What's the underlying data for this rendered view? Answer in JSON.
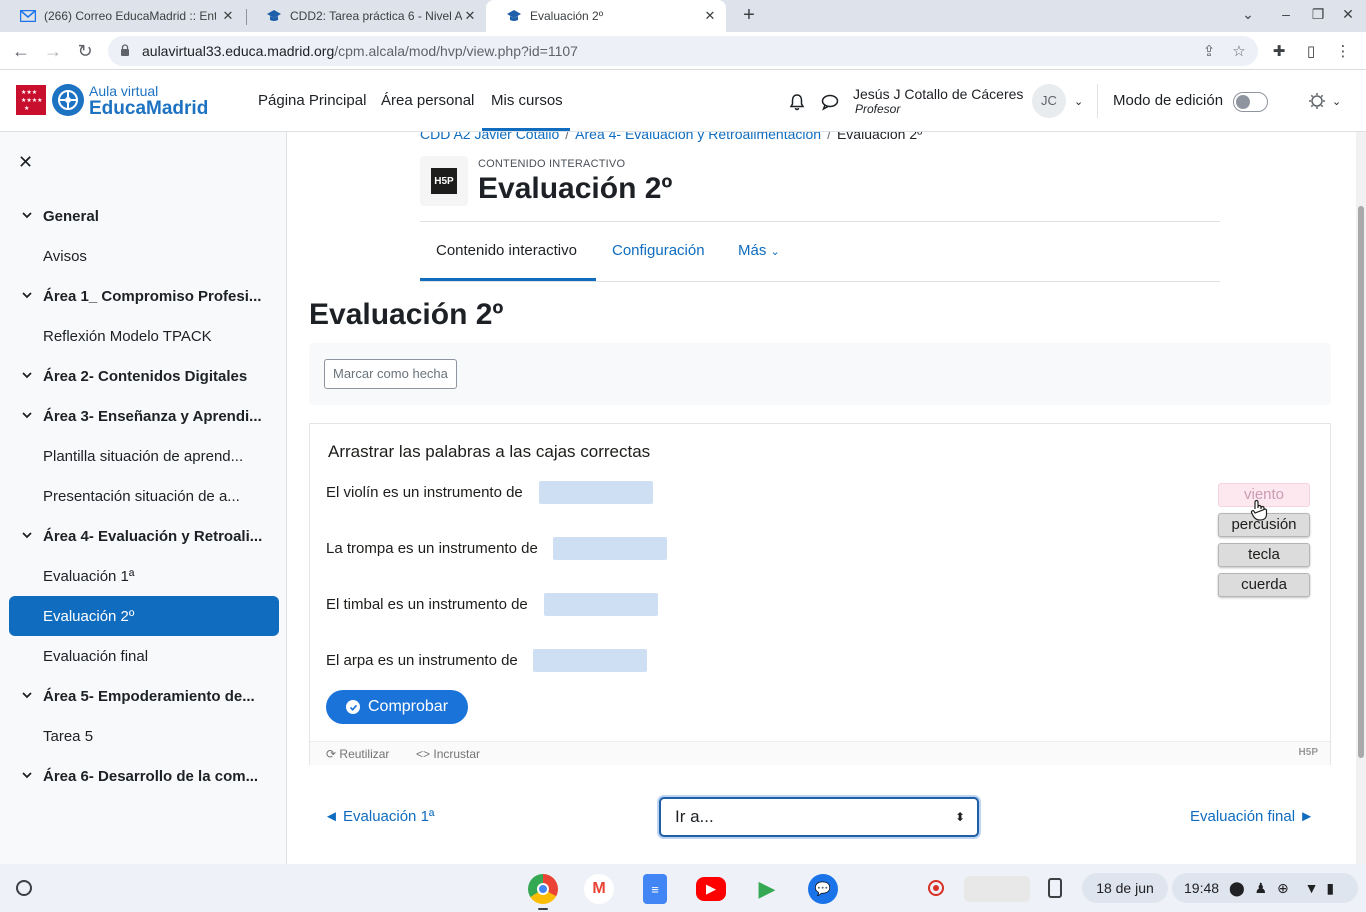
{
  "browser": {
    "tabs": [
      {
        "title": "(266) Correo EducaMadrid :: Ent",
        "icon": "mail-icon"
      },
      {
        "title": "CDD2: Tarea práctica 6 - Nivel A",
        "icon": "moodle-cap-icon"
      },
      {
        "title": "Evaluación 2º",
        "icon": "moodle-cap-icon",
        "active": true
      }
    ],
    "url_host": "aulavirtual33.educa.madrid.org",
    "url_path": "/cpm.alcala/mod/hvp/view.php?id=1107"
  },
  "header": {
    "logo_small": "Aula virtual",
    "logo_big": "EducaMadrid",
    "nav": [
      "Página Principal",
      "Área personal",
      "Mis cursos"
    ],
    "user_name": "Jesús J Cotallo de Cáceres",
    "user_role": "Profesor",
    "avatar_initials": "JC",
    "edit_mode_label": "Modo de edición",
    "edit_mode_on": false
  },
  "sidebar": {
    "items": [
      {
        "label": "General",
        "type": "section"
      },
      {
        "label": "Avisos",
        "type": "activity"
      },
      {
        "label": "Área 1_ Compromiso Profesi...",
        "type": "section"
      },
      {
        "label": "Reflexión Modelo TPACK",
        "type": "activity"
      },
      {
        "label": "Área 2- Contenidos Digitales",
        "type": "section"
      },
      {
        "label": "Área 3- Enseñanza y Aprendi...",
        "type": "section"
      },
      {
        "label": "Plantilla situación de aprend...",
        "type": "activity"
      },
      {
        "label": "Presentación situación de a...",
        "type": "activity"
      },
      {
        "label": "Área 4- Evaluación y Retroali...",
        "type": "section"
      },
      {
        "label": "Evaluación 1ª",
        "type": "activity"
      },
      {
        "label": "Evaluación 2º",
        "type": "activity",
        "current": true
      },
      {
        "label": "Evaluación final",
        "type": "activity"
      },
      {
        "label": "Área 5- Empoderamiento de...",
        "type": "section"
      },
      {
        "label": "Tarea 5",
        "type": "activity"
      },
      {
        "label": "Área 6- Desarrollo de la com...",
        "type": "section"
      }
    ]
  },
  "breadcrumb": [
    "CDD A2 Javier Cotallo",
    "Área 4- Evaluación y Retroalimentación",
    "Evaluación 2º"
  ],
  "activity": {
    "type_label": "CONTENIDO INTERACTIVO",
    "title": "Evaluación 2º",
    "icon_text": "H5P",
    "tabs": [
      "Contenido interactivo",
      "Configuración",
      "Más"
    ],
    "page_heading": "Evaluación 2º",
    "mark_done": "Marcar como hecha"
  },
  "h5p": {
    "question": "Arrastrar las palabras a las cajas correctas",
    "sentences": [
      "El violín es un instrumento de",
      "La trompa es un instrumento de",
      "El timbal es un instrumento de",
      "El arpa es un instrumento de"
    ],
    "words": [
      "viento",
      "percusión",
      "tecla",
      "cuerda"
    ],
    "check_button": "Comprobar",
    "footer_reuse": "Reutilizar",
    "footer_embed": "Incrustar",
    "footer_logo": "H5P"
  },
  "navigation": {
    "prev": "◄ Evaluación 1ª",
    "jump_placeholder": "Ir a...",
    "next": "Evaluación final ►"
  },
  "shelf": {
    "date": "18 de jun",
    "time": "19:48"
  },
  "colors": {
    "accent": "#0f6cbf",
    "dropzone": "#cfdff3",
    "check_button": "#1a73d9"
  }
}
